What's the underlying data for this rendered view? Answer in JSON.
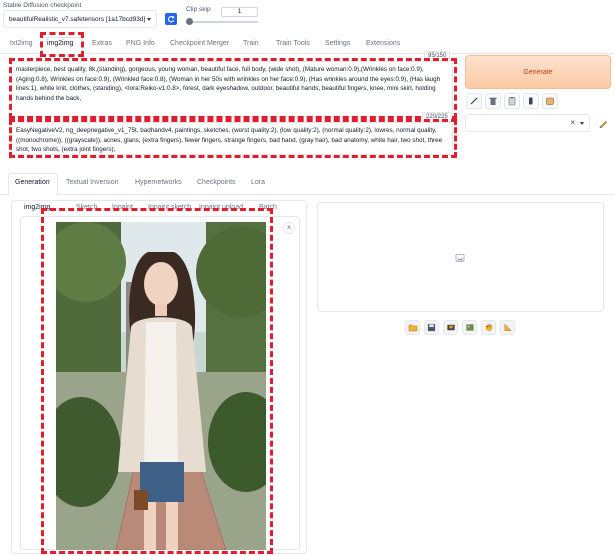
{
  "checkpoint": {
    "label": "Stable Diffusion checkpoint",
    "value": "beautifulRealistic_v7.safetensors [1a17bcd93d]"
  },
  "clip_skip": {
    "label": "Clip skip",
    "value": "1",
    "level": 0.0
  },
  "main_tabs": [
    {
      "label": "txt2img"
    },
    {
      "label": "img2img"
    },
    {
      "label": "Extras"
    },
    {
      "label": "PNG Info"
    },
    {
      "label": "Checkpoint Merger"
    },
    {
      "label": "Train"
    },
    {
      "label": "Train Tools"
    },
    {
      "label": "Settings"
    },
    {
      "label": "Extensions"
    }
  ],
  "prompt": {
    "counter": "95/150",
    "text": "masterpiece, best quality, 8k,(standing), gorgeous, young woman, beautiful face, full body, (wide shot), (Mature woman:0.9),(Wrinkles on face:0.9), (Aging:0.8), Wrinkles on face:0.9), (Wrinkled face:0.8), (Woman in her 50s with wrinkles on her face:0.9), (Has wrinkles around the eyes:0.9), (Has laugh lines:1), white knit, clothes, (standing), <lora:Reiko-v1:0.8>, forest, dark eyeshadow, outdoor, beautiful hands, beautiful fingers, knee, mini skirt, holding hands behind the back,"
  },
  "negative_prompt": {
    "counter": "220/225",
    "text": "EasyNegativeV2, ng_deepnegative_v1_75t, badhandv4, paintings, sketches, (worst quality:2), (low quality:2), (normal quality:2), lowres, normal quality, ((monochrome)), ((grayscale)), acnes, glans, (extra fingers), fewer fingers, strange fingers, bad hand, (gray hair), bad anatomy, white hair, two shot, three shot, two shots, (extra joint fingers),"
  },
  "generate_label": "Generate",
  "style_select": {
    "value": "",
    "clear": "×"
  },
  "sub_tabs": [
    {
      "label": "Generation"
    },
    {
      "label": "Textual Inversion"
    },
    {
      "label": "Hypernetworks"
    },
    {
      "label": "Checkpoints"
    },
    {
      "label": "Lora"
    }
  ],
  "mode_tabs": [
    {
      "label": "img2img"
    },
    {
      "label": "Sketch"
    },
    {
      "label": "Inpaint"
    },
    {
      "label": "Inpaint sketch"
    },
    {
      "label": "Inpaint upload"
    },
    {
      "label": "Batch"
    }
  ],
  "image_close": "×",
  "colors": {
    "accent_orange": "#f97316",
    "generate_bg": "#fcd2b6",
    "generate_text": "#c2410c",
    "highlight_red": "#e11d2e"
  }
}
